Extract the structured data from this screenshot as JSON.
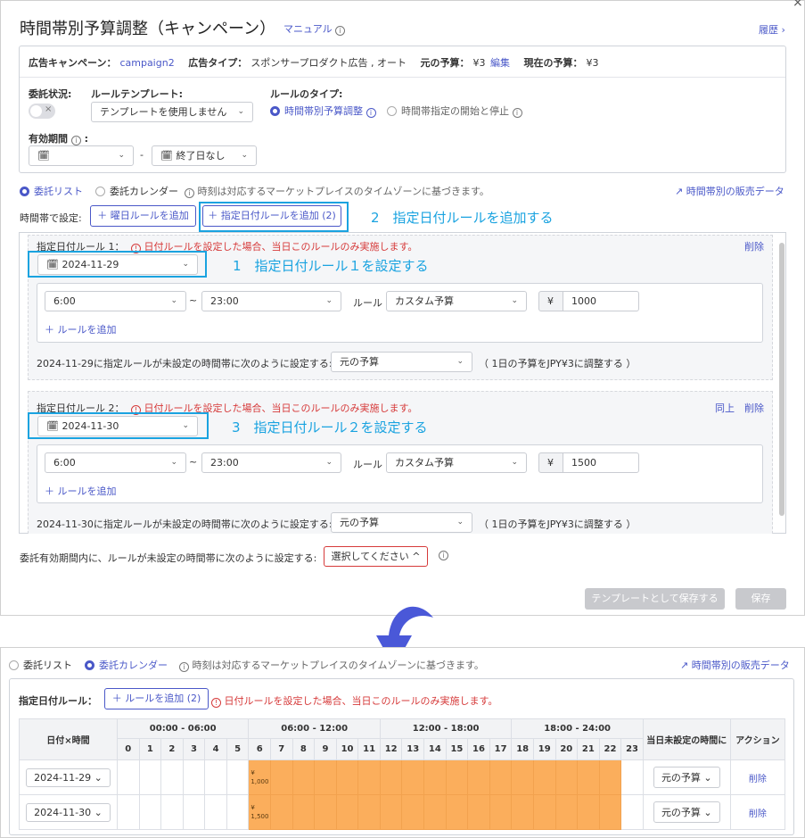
{
  "dialog": {
    "title": "時間帯別予算調整（キャンペーン）",
    "manual_link": "マニュアル",
    "history_link": "履歴 ›",
    "close_glyph": "×"
  },
  "campaign_info": {
    "campaign_label": "広告キャンペーン：",
    "campaign_value": "campaign2",
    "adtype_label": "広告タイプ：",
    "adtype_value": "スポンサープロダクト広告 , オート",
    "orig_budget_label": "元の予算：",
    "orig_budget_value": "¥3",
    "edit_link": "編集",
    "current_budget_label": "現在の予算：",
    "current_budget_value": "¥3"
  },
  "settings": {
    "delegation_label": "委託状況:",
    "toggle_glyph": "×",
    "template_label": "ルールテンプレート:",
    "template_value": "テンプレートを使用しません",
    "rule_type_label": "ルールのタイプ:",
    "rule_type_opt1": "時間帯別予算調整",
    "rule_type_opt2": "時間帯指定の開始と停止",
    "validity_label": "有効期間",
    "end_date_placeholder": "終了日なし",
    "dash": "-"
  },
  "view_toggle": {
    "list": "委託リスト",
    "calendar": "委託カレンダー",
    "tz_note": "時刻は対応するマーケットプレイスのタイムゾーンに基づきます。",
    "sales_data": "時間帯別の販売データ"
  },
  "time_setting": {
    "label": "時間帯で設定:",
    "add_weekday": "＋ 曜日ルールを追加",
    "add_date": "＋ 指定日付ルールを追加 (2)"
  },
  "annotations": {
    "a1": "1　指定日付ルール１を設定する",
    "a2": "2　指定日付ルールを追加する",
    "a3": "3　指定日付ルール２を設定する"
  },
  "rules": [
    {
      "title": "指定日付ルール 1：",
      "warning": "日付ルールを設定した場合、当日このルールのみ実施します。",
      "delete": "削除",
      "same": "",
      "date": "2024-11-29",
      "from": "6:00",
      "to": "23:00",
      "rule_label": "ルール",
      "rule_type": "カスタム予算",
      "currency": "¥",
      "amount": "1000",
      "add_rule": "＋ ルールを追加",
      "unset_label": "2024-11-29に指定ルールが未設定の時間帯に次のように設定する:",
      "unset_value": "元の予算",
      "unset_note": "（ 1日の予算をJPY¥3に調整する ）"
    },
    {
      "title": "指定日付ルール 2：",
      "warning": "日付ルールを設定した場合、当日このルールのみ実施します。",
      "delete": "削除",
      "same": "同上",
      "date": "2024-11-30",
      "from": "6:00",
      "to": "23:00",
      "rule_label": "ルール",
      "rule_type": "カスタム予算",
      "currency": "¥",
      "amount": "1500",
      "add_rule": "＋ ルールを追加",
      "unset_label": "2024-11-30に指定ルールが未設定の時間帯に次のように設定する:",
      "unset_value": "元の予算",
      "unset_note": "（ 1日の予算をJPY¥3に調整する ）"
    }
  ],
  "footer": {
    "unset_label": "委託有効期間内に、ルールが未設定の時間帯に次のように設定する:",
    "select_placeholder": "選択してください ^",
    "save_template": "テンプレートとして保存する",
    "save": "保存"
  },
  "calendar": {
    "list": "委託リスト",
    "calendar": "委託カレンダー",
    "tz_note": "時刻は対応するマーケットプレイスのタイムゾーンに基づきます。",
    "sales_data": "時間帯別の販売データ",
    "date_rule_label": "指定日付ルール：",
    "add_rule": "＋ ルールを追加 (2)",
    "warning": "日付ルールを設定した場合、当日このルールのみ実施します。",
    "col_date": "日付×時間",
    "col_unset": "当日未設定の時間に",
    "col_action": "アクション",
    "ranges": [
      "00:00 - 06:00",
      "06:00 - 12:00",
      "12:00 - 18:00",
      "18:00 - 24:00"
    ],
    "hours": [
      "0",
      "1",
      "2",
      "3",
      "4",
      "5",
      "6",
      "7",
      "8",
      "9",
      "10",
      "11",
      "12",
      "13",
      "14",
      "15",
      "16",
      "17",
      "18",
      "19",
      "20",
      "21",
      "22",
      "23"
    ],
    "rows": [
      {
        "date": "2024-11-29",
        "from": 6,
        "to": 23,
        "label_currency": "¥",
        "label_amount": "1,000",
        "unset": "元の予算",
        "action": "削除"
      },
      {
        "date": "2024-11-30",
        "from": 6,
        "to": 23,
        "label_currency": "¥",
        "label_amount": "1,500",
        "unset": "元の予算",
        "action": "削除"
      }
    ],
    "active_color": "#fbae5c"
  }
}
